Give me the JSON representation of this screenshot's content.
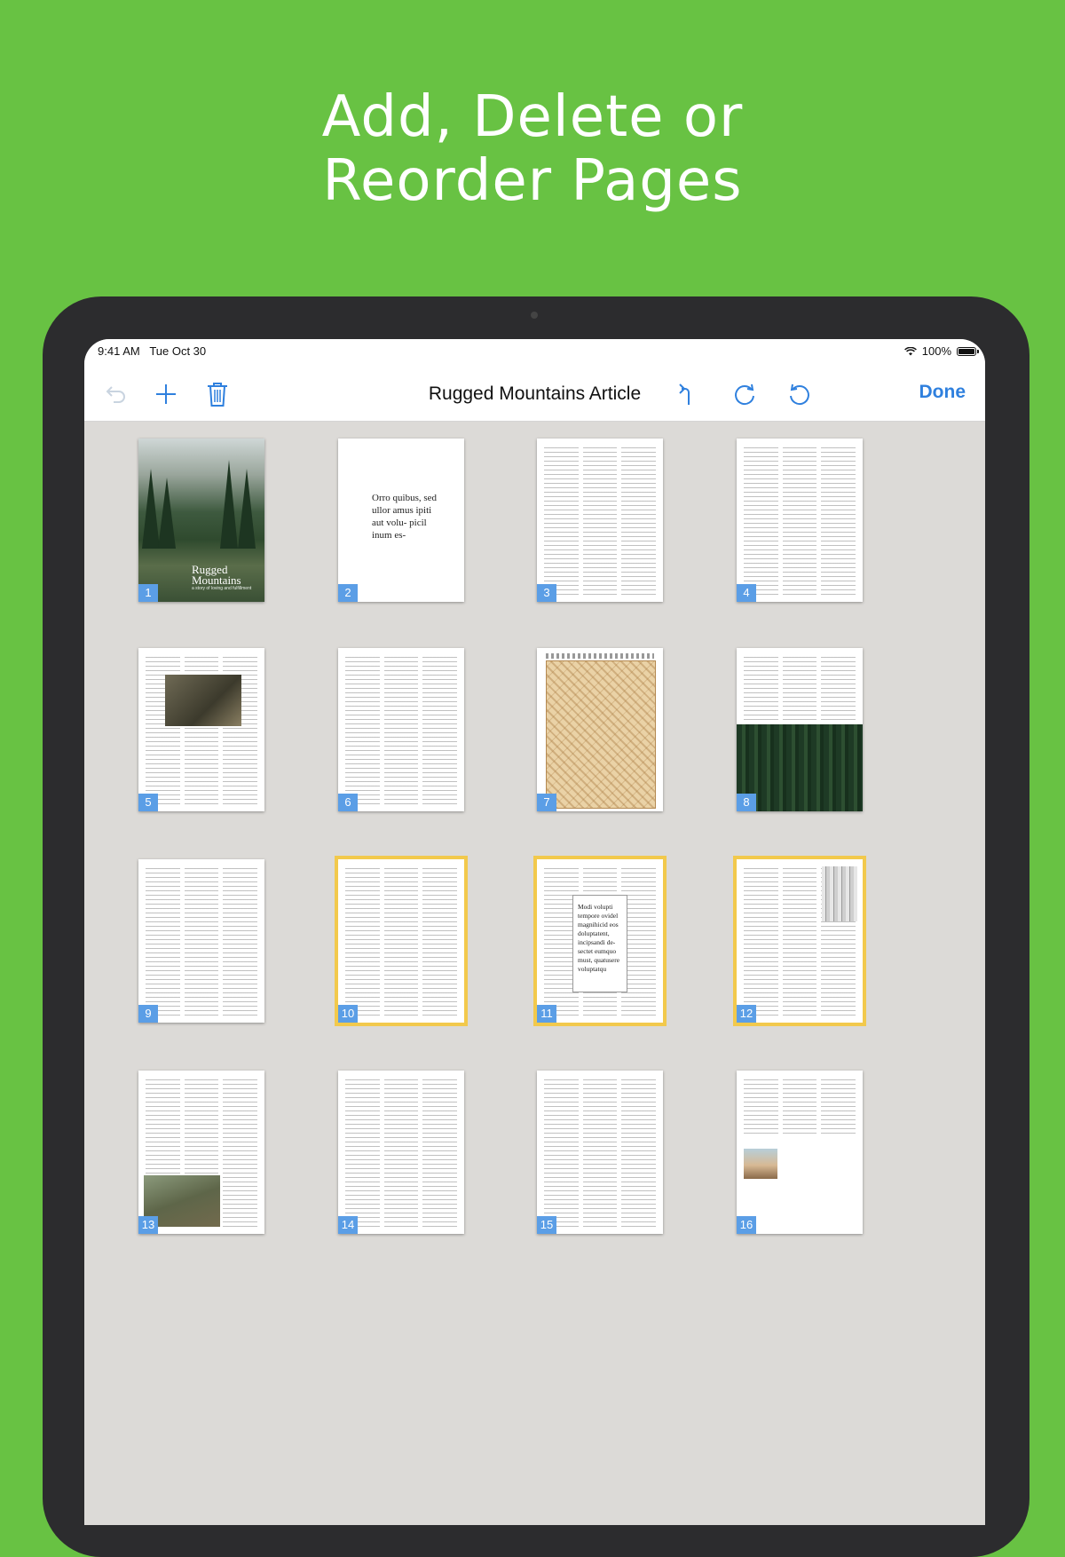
{
  "headline": {
    "line1": "Add, Delete or",
    "line2": "Reorder Pages"
  },
  "status_bar": {
    "time": "9:41 AM",
    "date": "Tue Oct 30",
    "battery": "100%"
  },
  "toolbar": {
    "title": "Rugged Mountains Article",
    "done_label": "Done",
    "icons": [
      "undo-disabled-icon",
      "add-icon",
      "trash-icon",
      "rotate-left-icon",
      "redo-icon",
      "undo-icon"
    ]
  },
  "pages": [
    {
      "number": "1",
      "kind": "cover",
      "title": "Rugged Mountains",
      "subtitle": "a story of loving and fulfillment"
    },
    {
      "number": "2",
      "kind": "pullquote",
      "text": "Orro quibus, sed ullor amus ipiti aut volu- picil inum es-"
    },
    {
      "number": "3",
      "kind": "text"
    },
    {
      "number": "4",
      "kind": "text"
    },
    {
      "number": "5",
      "kind": "text-photo"
    },
    {
      "number": "6",
      "kind": "text"
    },
    {
      "number": "7",
      "kind": "map"
    },
    {
      "number": "8",
      "kind": "text-forest"
    },
    {
      "number": "9",
      "kind": "text"
    },
    {
      "number": "10",
      "kind": "text",
      "selected": true
    },
    {
      "number": "11",
      "kind": "callout",
      "selected": true,
      "text": "Modi volupti tempore ovidel magnihicid eos doluptatent, incipsandi de- sectet eumquo must, quatusere voluptatqu"
    },
    {
      "number": "12",
      "kind": "text-photo-right",
      "selected": true
    },
    {
      "number": "13",
      "kind": "text-photo-bottom"
    },
    {
      "number": "14",
      "kind": "text"
    },
    {
      "number": "15",
      "kind": "text"
    },
    {
      "number": "16",
      "kind": "text-portrait"
    }
  ]
}
